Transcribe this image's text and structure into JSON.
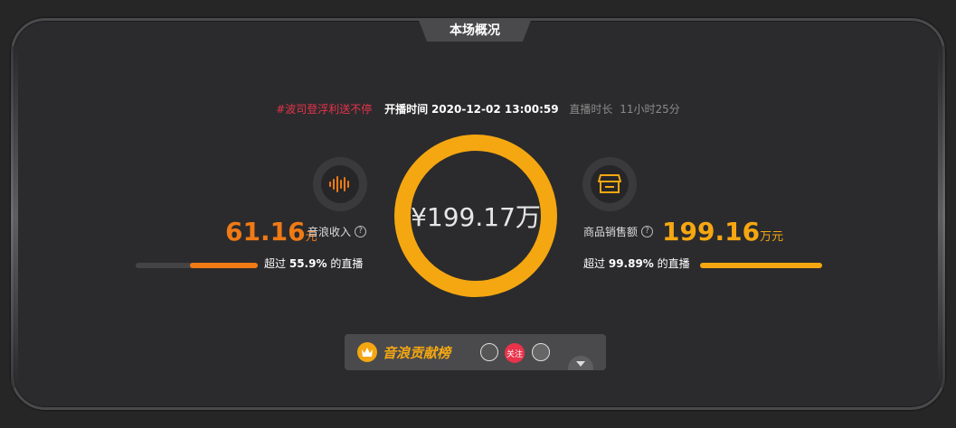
{
  "header": {
    "tab_label": "本场概况"
  },
  "info": {
    "hashtag": "#波司登浮利送不停",
    "start_label": "开播时间",
    "start_time": "2020-12-02 13:00:59",
    "duration_label": "直播时长",
    "duration_value": "11小时25分"
  },
  "center": {
    "total": "¥199.17万"
  },
  "left_stat": {
    "value": "61.16",
    "unit": "元",
    "label": "音浪收入",
    "exceed_prefix": "超过",
    "exceed_value": "55.9%",
    "exceed_suffix": "的直播",
    "percent": 55.9,
    "color": "#f07a14",
    "icon": "sound-wave-icon"
  },
  "right_stat": {
    "value": "199.16",
    "unit": "万元",
    "label": "商品销售额",
    "exceed_prefix": "超过",
    "exceed_value": "99.89%",
    "exceed_suffix": "的直播",
    "percent": 99.89,
    "color": "#f5a711",
    "icon": "store-icon"
  },
  "ranking": {
    "title": "音浪贡献榜",
    "follow_label": "关注"
  }
}
